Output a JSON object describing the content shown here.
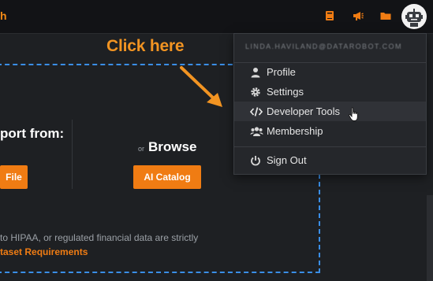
{
  "topbar": {
    "brand_fragment": "h",
    "icons": [
      "notebook-icon",
      "megaphone-icon",
      "folder-icon",
      "robot-avatar-icon"
    ]
  },
  "main": {
    "import_title": "port from:",
    "file_button": "File",
    "or_text": "or",
    "browse_title": "Browse",
    "ai_catalog_button": "AI Catalog",
    "note": "to HIPAA, or regulated financial data are strictly",
    "requirements_link": "taset Requirements"
  },
  "annotation": {
    "callout": "Click here"
  },
  "menu": {
    "email": "LINDA.HAVILAND@DATAROBOT.COM",
    "items": [
      {
        "label": "Profile",
        "icon": "user-icon"
      },
      {
        "label": "Settings",
        "icon": "gear-icon"
      },
      {
        "label": "Developer Tools",
        "icon": "code-icon",
        "state": "hover"
      },
      {
        "label": "Membership",
        "icon": "users-icon"
      },
      {
        "label": "Sign Out",
        "icon": "power-icon"
      }
    ]
  },
  "colors": {
    "accent": "#f07c13",
    "dropzone_border": "#3a8ee6",
    "background": "#1e2023",
    "menu_background": "#25272b"
  }
}
